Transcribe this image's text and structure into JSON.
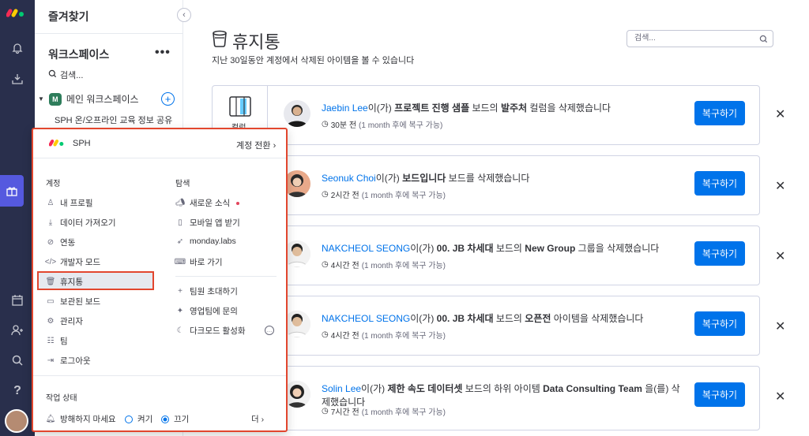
{
  "sidebar": {
    "favorites": "즐겨찾기",
    "workspace_title": "워크스페이스",
    "workspace_more": "•••",
    "search": "검색...",
    "main_workspace": "메인 워크스페이스",
    "main_workspace_badge": "M",
    "board_item": "SPH 온/오프라인 교육 정보 공유"
  },
  "page": {
    "title": "휴지통",
    "subtitle": "지난 30일동안 계정에서 삭제된 아이템을 볼 수 있습니다",
    "search_placeholder": "검색..."
  },
  "items": [
    {
      "user": "Jaebin Lee",
      "mid": "이(가) ",
      "board": "프로젝트 진행 샘플",
      "post": " 보드의 ",
      "target": "발주처",
      "tail": " 컬럼을 삭제했습니다",
      "time": "30분 전",
      "note": "(1 month 후에 복구 가능)",
      "thumb_label": "컬럼"
    },
    {
      "user": "Seonuk Choi",
      "mid": "이(가) ",
      "board": "보드입니다",
      "post": " 보드를 삭제했습니다",
      "target": "",
      "tail": "",
      "time": "2시간 전",
      "note": "(1 month 후에 복구 가능)"
    },
    {
      "user": "NAKCHEOL SEONG",
      "mid": "이(가) ",
      "board": "00. JB 차세대",
      "post": " 보드의 ",
      "target": "New Group",
      "tail": " 그룹을 삭제했습니다",
      "time": "4시간 전",
      "note": "(1 month 후에 복구 가능)"
    },
    {
      "user": "NAKCHEOL SEONG",
      "mid": "이(가) ",
      "board": "00. JB 차세대",
      "post": " 보드의 ",
      "target": "오픈전",
      "tail": " 아이템을 삭제했습니다",
      "time": "4시간 전",
      "note": "(1 month 후에 복구 가능)"
    },
    {
      "user": "Solin Lee",
      "mid": "이(가) ",
      "board": "제한 속도 데이터셋",
      "post": " 보드의 하위 아이템 ",
      "target": "Data Consulting Team",
      "tail": " 을(를) 삭",
      "tail2": "제했습니다",
      "time": "7시간 전",
      "note": "(1 month 후에 복구 가능)"
    }
  ],
  "restore_label": "복구하기",
  "menu": {
    "account": "SPH",
    "switch": "계정 전환 ›",
    "account_header": "계정",
    "explore_header": "탐색",
    "left": [
      "내 프로필",
      "데이터 가져오기",
      "연동",
      "개발자 모드",
      "휴지통",
      "보관된 보드",
      "관리자",
      "팀",
      "로그아웃"
    ],
    "right": [
      "새로운 소식",
      "모바일 앱 받기",
      "monday.labs",
      "바로 가기",
      "팀원 초대하기",
      "영업팀에 문의",
      "다크모드 활성화"
    ],
    "status_header": "작업 상태",
    "dnd": "방해하지 마세요",
    "on": "켜기",
    "off": "끄기",
    "more": "더 ›"
  }
}
